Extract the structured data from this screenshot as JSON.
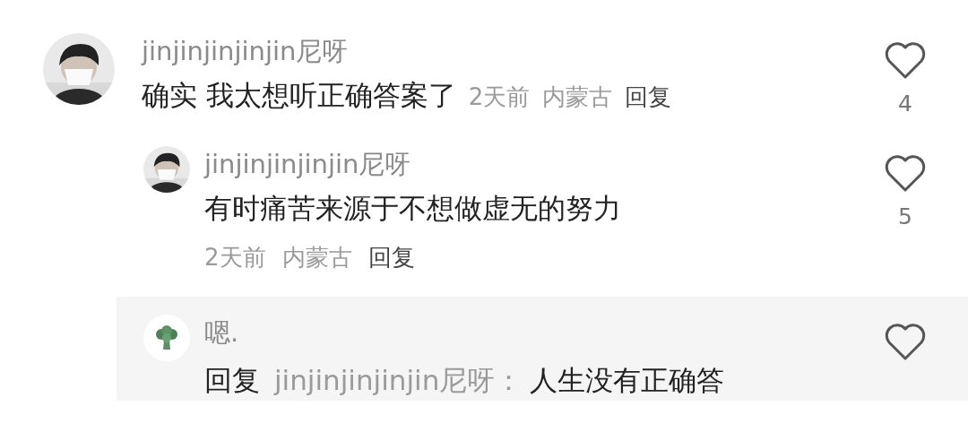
{
  "comments": [
    {
      "username": "jinjinjinjinjin尼呀",
      "text": "确实 我太想听正确答案了",
      "time": "2天前",
      "location": "内蒙古",
      "reply_action": "回复",
      "likes": "4",
      "replies": [
        {
          "username": "jinjinjinjinjin尼呀",
          "text": "有时痛苦来源于不想做虚无的努力",
          "time": "2天前",
          "location": "内蒙古",
          "reply_action": "回复",
          "likes": "5"
        }
      ]
    }
  ],
  "highlighted_reply": {
    "avatar": {
      "kind": "icon"
    },
    "username": "嗯.",
    "reply_label": "回复",
    "reply_to": "jinjinjinjinjin尼呀：",
    "text": "人生没有正确答"
  }
}
